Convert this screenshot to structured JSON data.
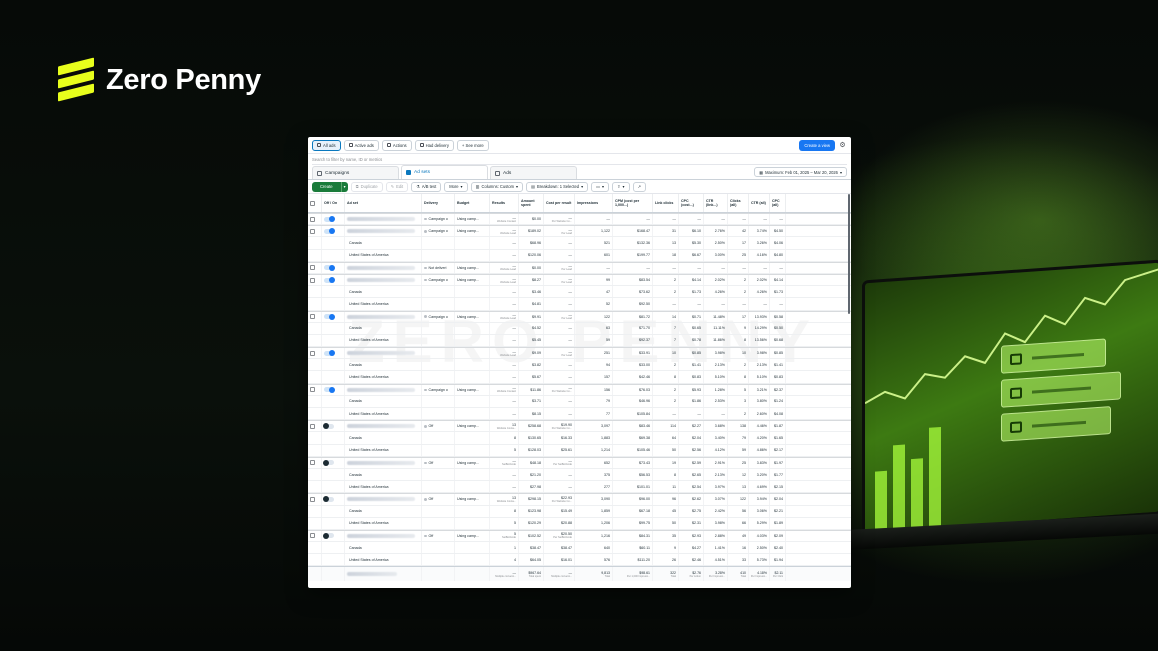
{
  "brand": {
    "name": "Zero Penny"
  },
  "ads_manager": {
    "view_tabs": [
      {
        "label": "All ads",
        "active": true,
        "icon": "folder-icon"
      },
      {
        "label": "Active ads",
        "active": false,
        "icon": "play-icon"
      },
      {
        "label": "Actions",
        "active": false,
        "icon": "bell-icon"
      },
      {
        "label": "Had delivery",
        "active": false,
        "icon": "chart-icon"
      },
      {
        "label": "+ See more",
        "active": false,
        "icon": "plus-icon"
      }
    ],
    "create_view_label": "Create a view",
    "search_placeholder": "Search to filter by name, ID or metrics",
    "levels": [
      {
        "label": "Campaigns",
        "active": false
      },
      {
        "label": "Ad sets",
        "active": true
      },
      {
        "label": "Ads",
        "active": false
      }
    ],
    "date_range": "Maximum: Feb 01, 2025 – Mar 20, 2026",
    "toolbar": {
      "create": "Create",
      "duplicate": "Duplicate",
      "edit": "Edit",
      "ab_test": "A/B test",
      "more": "More",
      "columns": "Columns: Custom",
      "breakdown": "Breakdown: 1 Selected"
    },
    "columns": [
      "Off / On",
      "Ad set",
      "Delivery",
      "Budget",
      "Results",
      "Amount spent",
      "Cost per result",
      "Impressions",
      "CPM (cost per 1,000...)",
      "Link clicks",
      "CPC (cost...)",
      "CTR (link...)",
      "Clicks (all)",
      "CTR (all)",
      "CPC (all)"
    ],
    "rows": [
      {
        "type": "parent",
        "toggle": "on",
        "delivery": "Campaign o",
        "budget": "Using camp...",
        "results": "—",
        "results_sub": "Website Contact",
        "spent": "$0.00",
        "cpr": "—",
        "cpr_sub": "Per Website Co...",
        "imp": "—",
        "cpm": "—",
        "link": "—",
        "cpc": "—",
        "ctr": "—",
        "clicks": "—",
        "ctr_all": "—",
        "cpc_all": "—"
      },
      {
        "type": "parent",
        "toggle": "on",
        "delivery": "Campaign o",
        "budget": "Using camp...",
        "results": "—",
        "results_sub": "Website Lead",
        "spent": "$189.02",
        "cpr": "—",
        "cpr_sub": "Per Lead",
        "imp": "1,122",
        "cpm": "$168.47",
        "link": "31",
        "cpc": "$6.10",
        "ctr": "2.76%",
        "clicks": "42",
        "ctr_all": "3.74%",
        "cpc_all": "$4.50"
      },
      {
        "type": "child",
        "name": "Canada",
        "results": "—",
        "spent": "$68.96",
        "cpr": "—",
        "imp": "521",
        "cpm": "$132.36",
        "link": "13",
        "cpc": "$5.30",
        "ctr": "2.50%",
        "clicks": "17",
        "ctr_all": "3.26%",
        "cpc_all": "$4.06"
      },
      {
        "type": "child",
        "name": "United States of America",
        "results": "—",
        "spent": "$120.06",
        "cpr": "—",
        "imp": "601",
        "cpm": "$199.77",
        "link": "18",
        "cpc": "$6.67",
        "ctr": "3.00%",
        "clicks": "25",
        "ctr_all": "4.16%",
        "cpc_all": "$4.80"
      },
      {
        "type": "parent",
        "toggle": "on",
        "delivery": "Not deliveri",
        "budget": "Using camp...",
        "results": "—",
        "results_sub": "Website Lead",
        "spent": "$0.00",
        "cpr": "—",
        "cpr_sub": "Per Lead",
        "imp": "—",
        "cpm": "—",
        "link": "—",
        "cpc": "—",
        "ctr": "—",
        "clicks": "—",
        "ctr_all": "—",
        "cpc_all": "—"
      },
      {
        "type": "parent",
        "toggle": "on",
        "delivery": "Campaign o",
        "budget": "Using camp...",
        "results": "—",
        "results_sub": "Website Lead",
        "spent": "$8.27",
        "cpr": "—",
        "cpr_sub": "Per Lead",
        "imp": "99",
        "cpm": "$83.54",
        "link": "2",
        "cpc": "$4.14",
        "ctr": "2.02%",
        "clicks": "2",
        "ctr_all": "2.02%",
        "cpc_all": "$4.14"
      },
      {
        "type": "child",
        "name": "Canada",
        "results": "—",
        "spent": "$3.46",
        "cpr": "—",
        "imp": "47",
        "cpm": "$73.62",
        "link": "2",
        "cpc": "$1.73",
        "ctr": "4.26%",
        "clicks": "2",
        "ctr_all": "4.26%",
        "cpc_all": "$1.73"
      },
      {
        "type": "child",
        "name": "United States of America",
        "results": "—",
        "spent": "$4.81",
        "cpr": "—",
        "imp": "52",
        "cpm": "$92.50",
        "link": "—",
        "cpc": "—",
        "ctr": "—",
        "clicks": "—",
        "ctr_all": "—",
        "cpc_all": "—"
      },
      {
        "type": "parent",
        "toggle": "on",
        "delivery": "Campaign o",
        "budget": "Using camp...",
        "results": "—",
        "results_sub": "Website Lead",
        "spent": "$9.91",
        "cpr": "—",
        "cpr_sub": "Per Lead",
        "imp": "122",
        "cpm": "$81.72",
        "link": "14",
        "cpc": "$0.71",
        "ctr": "11.48%",
        "clicks": "17",
        "ctr_all": "13.93%",
        "cpc_all": "$0.58"
      },
      {
        "type": "child",
        "name": "Canada",
        "results": "—",
        "spent": "$4.52",
        "cpr": "—",
        "imp": "63",
        "cpm": "$71.70",
        "link": "7",
        "cpc": "$0.65",
        "ctr": "11.11%",
        "clicks": "9",
        "ctr_all": "14.29%",
        "cpc_all": "$0.50"
      },
      {
        "type": "child",
        "name": "United States of America",
        "results": "—",
        "spent": "$5.45",
        "cpr": "—",
        "imp": "59",
        "cpm": "$92.37",
        "link": "7",
        "cpc": "$0.78",
        "ctr": "11.86%",
        "clicks": "8",
        "ctr_all": "13.56%",
        "cpc_all": "$0.68"
      },
      {
        "type": "parent",
        "toggle": "on",
        "delivery": "",
        "budget": "",
        "results": "—",
        "results_sub": "Website Lead",
        "spent": "$9.09",
        "cpr": "—",
        "cpr_sub": "Per Lead",
        "imp": "251",
        "cpm": "$33.91",
        "link": "10",
        "cpc": "$0.85",
        "ctr": "3.98%",
        "clicks": "10",
        "ctr_all": "3.98%",
        "cpc_all": "$0.85"
      },
      {
        "type": "child",
        "name": "Canada",
        "results": "—",
        "spent": "$3.82",
        "cpr": "—",
        "imp": "94",
        "cpm": "$33.00",
        "link": "2",
        "cpc": "$1.41",
        "ctr": "2.13%",
        "clicks": "2",
        "ctr_all": "2.13%",
        "cpc_all": "$1.41"
      },
      {
        "type": "child",
        "name": "United States of America",
        "results": "—",
        "spent": "$5.67",
        "cpr": "—",
        "imp": "157",
        "cpm": "$42.46",
        "link": "8",
        "cpc": "$0.83",
        "ctr": "5.10%",
        "clicks": "8",
        "ctr_all": "5.10%",
        "cpc_all": "$0.83"
      },
      {
        "type": "parent",
        "toggle": "on",
        "delivery": "Campaign o",
        "budget": "Using camp...",
        "results": "—",
        "results_sub": "Website Contact",
        "spent": "$11.86",
        "cpr": "—",
        "cpr_sub": "Per Website Co...",
        "imp": "156",
        "cpm": "$76.03",
        "link": "2",
        "cpc": "$5.93",
        "ctr": "1.28%",
        "clicks": "5",
        "ctr_all": "3.21%",
        "cpc_all": "$2.37"
      },
      {
        "type": "child",
        "name": "Canada",
        "results": "—",
        "spent": "$3.71",
        "cpr": "—",
        "imp": "79",
        "cpm": "$46.96",
        "link": "2",
        "cpc": "$1.86",
        "ctr": "2.53%",
        "clicks": "3",
        "ctr_all": "3.80%",
        "cpc_all": "$1.24"
      },
      {
        "type": "child",
        "name": "United States of America",
        "results": "—",
        "spent": "$8.15",
        "cpr": "—",
        "imp": "77",
        "cpm": "$105.84",
        "link": "—",
        "cpc": "—",
        "ctr": "—",
        "clicks": "2",
        "ctr_all": "2.60%",
        "cpc_all": "$4.08"
      },
      {
        "type": "parent",
        "toggle": "off",
        "delivery": "Off",
        "budget": "Using camp...",
        "results": "13",
        "results_sub": "Website Conta...",
        "spent": "$258.68",
        "cpr": "$19.90",
        "cpr_sub": "Per Website Co...",
        "imp": "3,097",
        "cpm": "$83.46",
        "link": "114",
        "cpc": "$2.27",
        "ctr": "3.68%",
        "clicks": "138",
        "ctr_all": "4.46%",
        "cpc_all": "$1.87"
      },
      {
        "type": "child",
        "name": "Canada",
        "results": "8",
        "spent": "$130.65",
        "cpr": "$16.33",
        "imp": "1,883",
        "cpm": "$69.38",
        "link": "64",
        "cpc": "$2.04",
        "ctr": "3.40%",
        "clicks": "79",
        "ctr_all": "4.20%",
        "cpc_all": "$1.65"
      },
      {
        "type": "child",
        "name": "United States of America",
        "results": "5",
        "spent": "$128.03",
        "cpr": "$25.61",
        "imp": "1,214",
        "cpm": "$105.46",
        "link": "50",
        "cpc": "$2.56",
        "ctr": "4.12%",
        "clicks": "59",
        "ctr_all": "4.86%",
        "cpc_all": "$2.17"
      },
      {
        "type": "parent",
        "toggle": "off",
        "delivery": "Off",
        "budget": "Using camp...",
        "results": "—",
        "results_sub": "SetBotCode",
        "spent": "$48.18",
        "cpr": "—",
        "cpr_sub": "Per SetBotCode",
        "imp": "652",
        "cpm": "$73.43",
        "link": "19",
        "cpc": "$2.59",
        "ctr": "2.91%",
        "clicks": "25",
        "ctr_all": "3.83%",
        "cpc_all": "$1.97"
      },
      {
        "type": "child",
        "name": "Canada",
        "results": "—",
        "spent": "$21.20",
        "cpr": "—",
        "imp": "375",
        "cpm": "$56.53",
        "link": "8",
        "cpc": "$2.65",
        "ctr": "2.13%",
        "clicks": "12",
        "ctr_all": "3.20%",
        "cpc_all": "$1.77"
      },
      {
        "type": "child",
        "name": "United States of America",
        "results": "—",
        "spent": "$27.98",
        "cpr": "—",
        "imp": "277",
        "cpm": "$101.01",
        "link": "11",
        "cpc": "$2.54",
        "ctr": "3.97%",
        "clicks": "13",
        "ctr_all": "4.69%",
        "cpc_all": "$2.15"
      },
      {
        "type": "parent",
        "toggle": "off",
        "delivery": "Off",
        "budget": "Using camp...",
        "results": "13",
        "results_sub": "Website Conta...",
        "spent": "$298.15",
        "cpr": "$22.93",
        "cpr_sub": "Per Website Co...",
        "imp": "3,090",
        "cpm": "$96.00",
        "link": "96",
        "cpc": "$2.62",
        "ctr": "3.07%",
        "clicks": "122",
        "ctr_all": "3.94%",
        "cpc_all": "$2.04"
      },
      {
        "type": "child",
        "name": "Canada",
        "results": "8",
        "spent": "$123.98",
        "cpr": "$15.49",
        "imp": "1,859",
        "cpm": "$67.18",
        "link": "45",
        "cpc": "$2.75",
        "ctr": "2.42%",
        "clicks": "56",
        "ctr_all": "3.06%",
        "cpc_all": "$2.21"
      },
      {
        "type": "child",
        "name": "United States of America",
        "results": "5",
        "spent": "$120.29",
        "cpr": "$20.88",
        "imp": "1,206",
        "cpm": "$99.75",
        "link": "50",
        "cpc": "$2.31",
        "ctr": "3.98%",
        "clicks": "66",
        "ctr_all": "5.29%",
        "cpc_all": "$1.89"
      },
      {
        "type": "parent",
        "toggle": "off",
        "delivery": "Off",
        "budget": "Using camp...",
        "results": "5",
        "results_sub": "SetBotCode",
        "spent": "$102.52",
        "cpr": "$20.50",
        "cpr_sub": "Per SetBotCode",
        "imp": "1,216",
        "cpm": "$84.31",
        "link": "35",
        "cpc": "$2.93",
        "ctr": "2.88%",
        "clicks": "49",
        "ctr_all": "4.03%",
        "cpc_all": "$2.09"
      },
      {
        "type": "child",
        "name": "Canada",
        "results": "1",
        "spent": "$38.47",
        "cpr": "$38.47",
        "imp": "640",
        "cpm": "$60.11",
        "link": "9",
        "cpc": "$4.27",
        "ctr": "1.41%",
        "clicks": "16",
        "ctr_all": "2.50%",
        "cpc_all": "$2.40"
      },
      {
        "type": "child",
        "name": "United States of America",
        "results": "4",
        "spent": "$64.05",
        "cpr": "$16.01",
        "imp": "576",
        "cpm": "$111.20",
        "link": "26",
        "cpc": "$2.46",
        "ctr": "4.51%",
        "clicks": "33",
        "ctr_all": "5.73%",
        "cpc_all": "$1.94"
      }
    ],
    "totals": {
      "results": "—",
      "results_sub": "Multiple conversi...",
      "spent": "$967.64",
      "spent_sub": "Total spent",
      "cpr": "—",
      "cpr_sub": "Multiple conversi...",
      "imp": "9,813",
      "imp_sub": "Total",
      "cpm": "$98.61",
      "cpm_sub": "Per 1,000 Impressi...",
      "link": "322",
      "link_sub": "Total",
      "cpc": "$2.76",
      "cpc_sub": "Per Action",
      "ctr": "3.28%",
      "ctr_sub": "Per Impressi...",
      "clicks": "410",
      "clicks_sub": "Total",
      "ctr_all": "4.18%",
      "ctr_all_sub": "Per Impressi...",
      "cpc_all": "$2.11",
      "cpc_all_sub": "Per Click"
    }
  }
}
